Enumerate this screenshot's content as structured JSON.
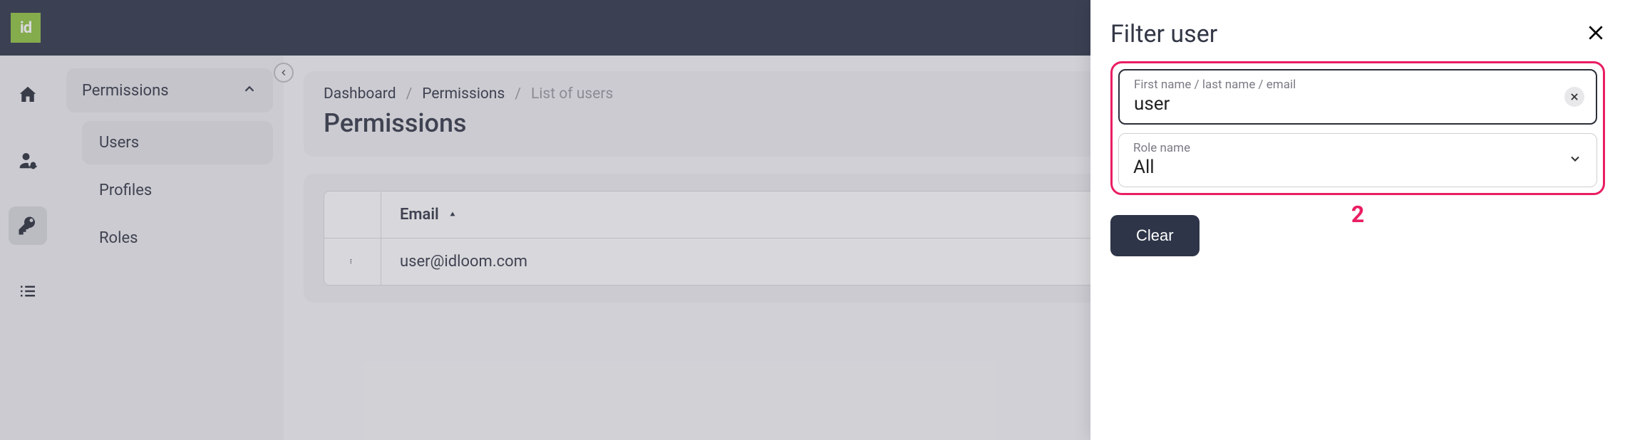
{
  "logo": "id",
  "sidebar": {
    "group": "Permissions",
    "items": [
      "Users",
      "Profiles",
      "Roles"
    ]
  },
  "breadcrumb": {
    "items": [
      "Dashboard",
      "Permissions",
      "List of users"
    ]
  },
  "page_title": "Permissions",
  "table": {
    "headers": [
      "Email"
    ],
    "rows": [
      {
        "email": "user@idloom.com"
      }
    ]
  },
  "slideover": {
    "title": "Filter user",
    "fields": {
      "search": {
        "label": "First name / last name / email",
        "value": "user"
      },
      "role": {
        "label": "Role name",
        "value": "All"
      }
    },
    "clear_label": "Clear",
    "annotation": "2"
  },
  "colors": {
    "accent": "#e91e63",
    "dark": "#2e3548",
    "logo_bg": "#8fc33f"
  }
}
